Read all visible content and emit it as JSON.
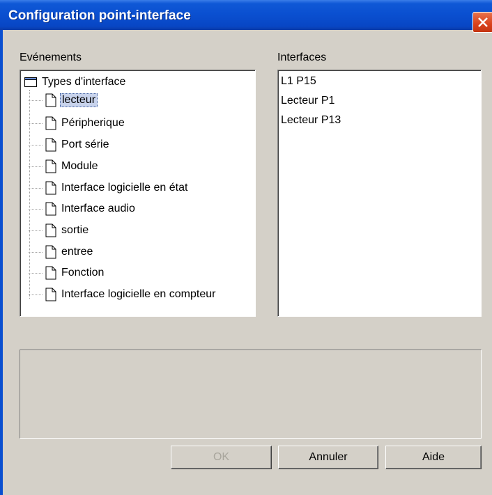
{
  "window": {
    "title": "Configuration point-interface"
  },
  "events": {
    "label": "Evénements",
    "root": "Types d'interface",
    "items": [
      "lecteur",
      "Péripherique",
      "Port série",
      "Module",
      "Interface logicielle en état",
      "Interface audio",
      "sortie",
      "entree",
      "Fonction",
      "Interface logicielle en compteur"
    ],
    "selected": "lecteur"
  },
  "interfaces": {
    "label": "Interfaces",
    "items": [
      "L1 P15",
      "Lecteur P1",
      "Lecteur P13"
    ]
  },
  "buttons": {
    "ok": "OK",
    "cancel": "Annuler",
    "help": "Aide"
  },
  "colors": {
    "title_bar": "#0a4fd0",
    "close_button": "#d9411c",
    "selection": "#c8d3ec",
    "dialog_bg": "#d4d0c8"
  }
}
